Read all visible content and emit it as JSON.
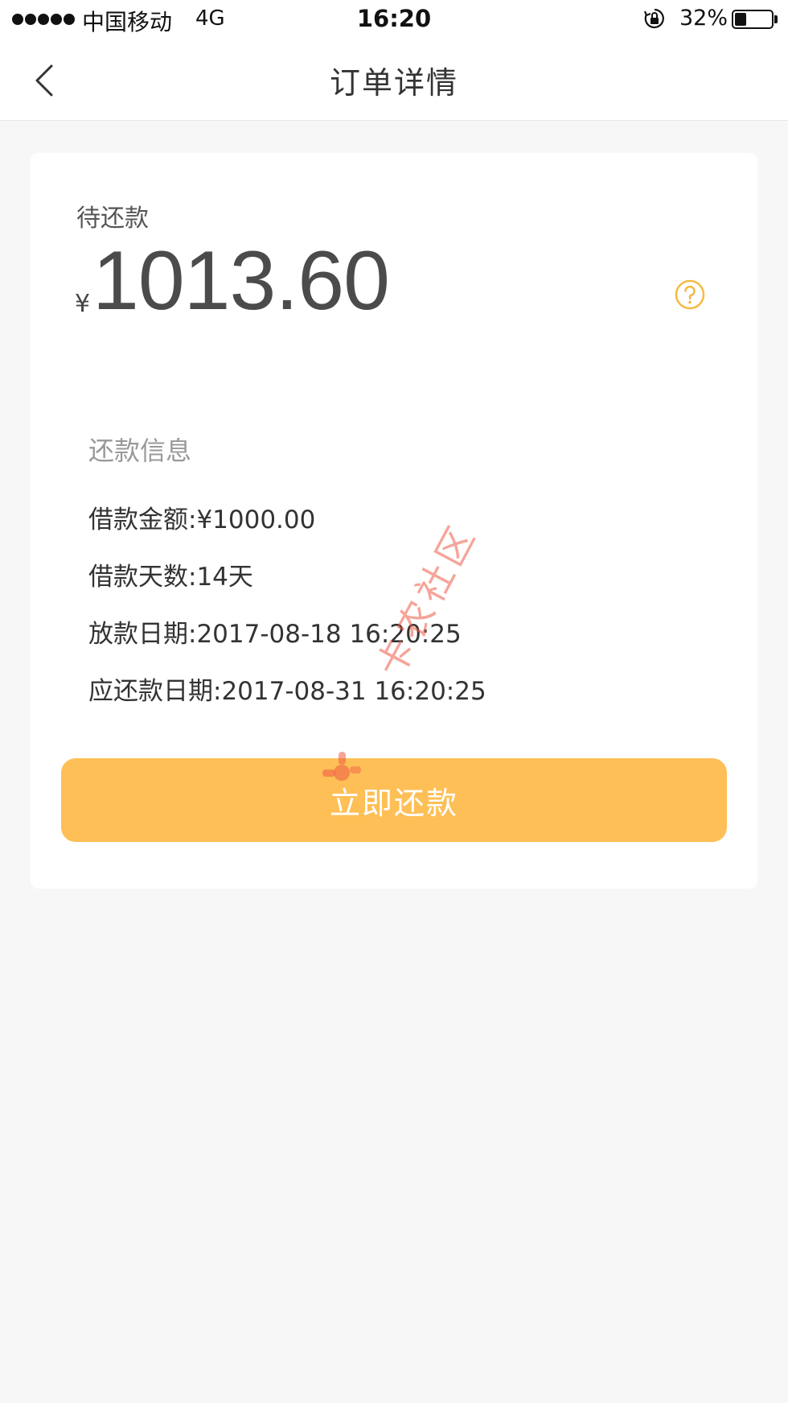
{
  "status_bar": {
    "carrier": "中国移动",
    "network": "4G",
    "time": "16:20",
    "battery_percent_text": "32%",
    "battery_level": 0.32
  },
  "nav": {
    "title": "订单详情",
    "back_icon": "chevron-left-icon"
  },
  "summary": {
    "label": "待还款",
    "currency_symbol": "¥",
    "amount": "1013.60",
    "help_icon": "question-circle-icon"
  },
  "repayment_info": {
    "title": "还款信息",
    "lines": [
      "借款金额:¥1000.00",
      "借款天数:14天",
      "放款日期:2017-08-18 16:20:25",
      "应还款日期:2017-08-31 16:20:25"
    ]
  },
  "pay_button": {
    "label": "立即还款"
  },
  "watermark": {
    "text": "卡农社区"
  },
  "colors": {
    "accent": "#fdbf56",
    "help_icon": "#f5b944",
    "page_bg": "#f7f7f7",
    "watermark": "#ee5a46"
  }
}
